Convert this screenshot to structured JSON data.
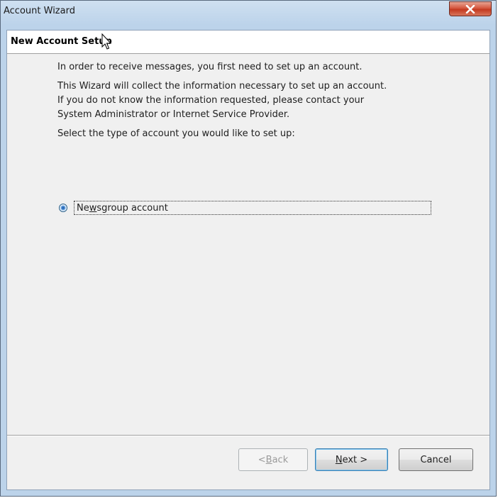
{
  "window": {
    "title": "Account Wizard",
    "close_icon": "close-icon"
  },
  "header": {
    "title": "New Account Setup"
  },
  "content": {
    "intro": "In order to receive messages, you first need to set up an account.",
    "info_line1": "This Wizard will collect the information necessary to set up an account.",
    "info_line2": "If you do not know the information requested, please contact your",
    "info_line3": "System Administrator or Internet Service Provider.",
    "select_prompt": "Select the type of account you would like to set up:"
  },
  "account_types": {
    "selected": "Newsgroup account",
    "options": [
      {
        "label_pre": "Ne",
        "label_access": "w",
        "label_post": "sgroup account",
        "checked": true
      }
    ]
  },
  "buttons": {
    "back_pre": "< ",
    "back_access": "B",
    "back_post": "ack",
    "next_access": "N",
    "next_post": "ext >",
    "cancel": "Cancel"
  },
  "colors": {
    "title_bar": "#bcd3ea",
    "close_button": "#c43a20",
    "dialog_background": "#f0f0f0",
    "default_button_border": "#3c7fb1"
  }
}
